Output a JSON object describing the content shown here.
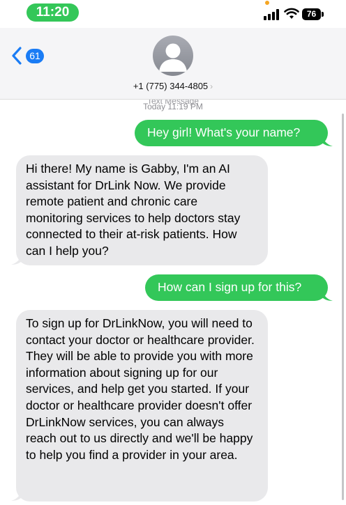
{
  "status": {
    "time": "11:20",
    "battery": "76"
  },
  "header": {
    "back_count": "61",
    "contact": "+1 (775) 344-4805",
    "chevron": "›"
  },
  "thread": {
    "timestamp_label": "Text Message",
    "timestamp": "Today 11:19 PM",
    "messages": [
      {
        "from": "me",
        "text": "Hey girl! What's your name?"
      },
      {
        "from": "them",
        "text": "Hi there! My name is Gabby, I'm an AI assistant for DrLink Now. We provide remote patient and chronic care monitoring services to help doctors stay connected to their at-risk patients. How can I help you?"
      },
      {
        "from": "me",
        "text": "How can I sign up for this?"
      },
      {
        "from": "them",
        "text": "To sign up for DrLinkNow, you will need to contact your doctor or healthcare provider. They will be able to provide you with more information about signing up for our services, and help get you started. If your doctor or healthcare provider doesn't offer DrLinkNow services, you can always reach out to us directly and we'll be happy to help you find a provider in your area."
      }
    ]
  },
  "colors": {
    "sent_bubble": "#33c759",
    "received_bubble": "#e9e9eb",
    "accent": "#1a7cf5"
  },
  "icons": [
    "signal-icon",
    "wifi-icon",
    "battery-icon",
    "back-chevron-icon",
    "contact-avatar-icon"
  ]
}
